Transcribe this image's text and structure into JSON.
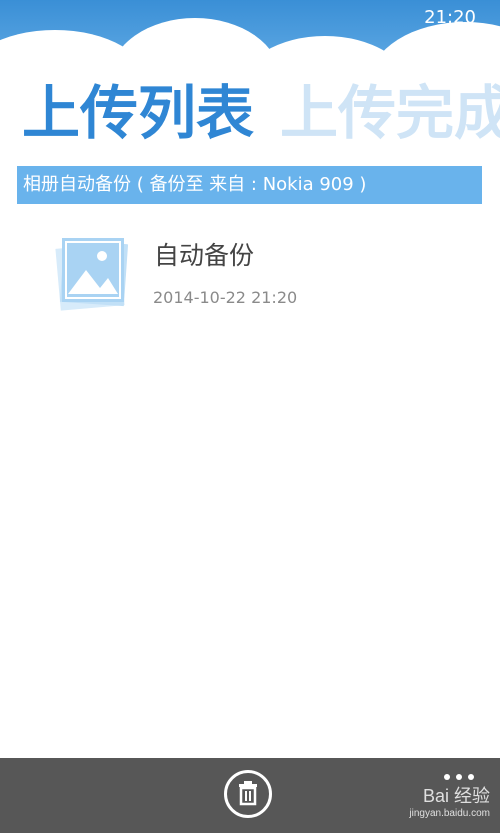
{
  "status_bar": {
    "time": "21:20"
  },
  "pivot": {
    "active": "上传列表",
    "inactive": "上传完成"
  },
  "group": {
    "title": "相册自动备份 ( 备份至  来自 : Nokia 909 )"
  },
  "items": [
    {
      "icon": "photo-album-icon",
      "title": "自动备份",
      "time": "2014-10-22 21:20"
    }
  ],
  "app_bar": {
    "delete_icon": "trash-icon",
    "more_icon": "ellipsis-icon",
    "watermark": "Bai 经验",
    "watermark_sub": "jingyan.baidu.com"
  },
  "colors": {
    "accent": "#2f86d4",
    "group_header_bg": "#69b3ec",
    "app_bar_bg": "#575757"
  }
}
